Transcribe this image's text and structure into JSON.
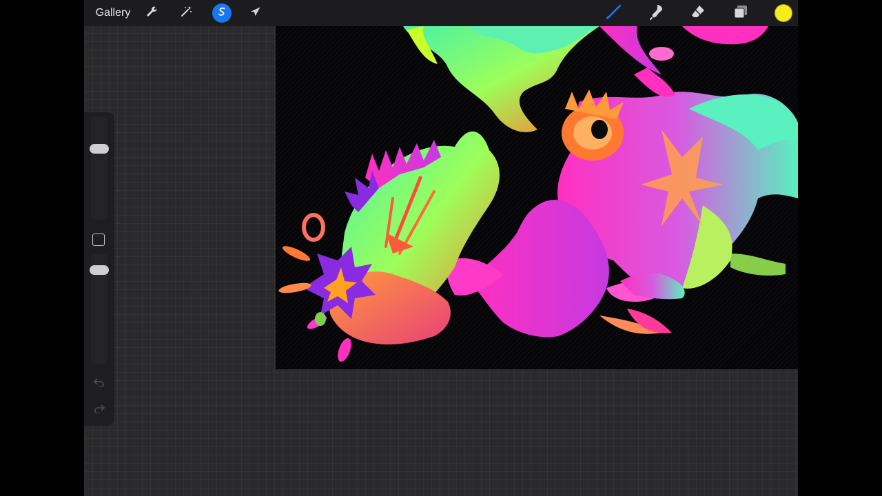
{
  "toolbar": {
    "gallery_label": "Gallery",
    "left_icons": [
      "wrench-icon",
      "magic-wand-icon",
      "selection-icon",
      "transform-arrow-icon"
    ],
    "right_icons": [
      "brush-icon",
      "smudge-icon",
      "eraser-icon",
      "layers-icon"
    ],
    "active_tool": "selection",
    "active_color": "#f5ed1a",
    "accent_color": "#1778f2"
  },
  "sidebar": {
    "controls": [
      "brush-size-slider",
      "modify-button",
      "opacity-slider",
      "undo-button",
      "redo-button"
    ]
  },
  "canvas": {
    "background": "#050507",
    "artwork_colors": [
      "#ff2fc0",
      "#48f0a8",
      "#ff7a30",
      "#8a2be2",
      "#c8ff2a"
    ]
  }
}
